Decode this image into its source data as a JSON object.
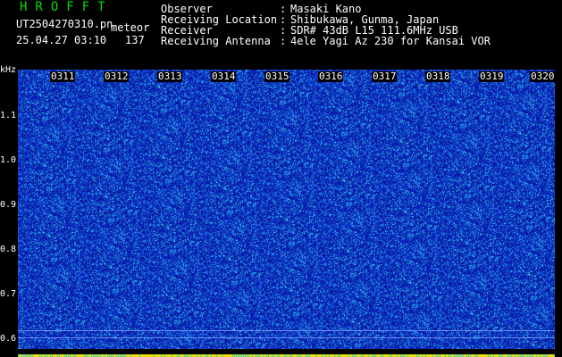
{
  "header": {
    "app_title": "HROFFT",
    "file_name": "UT2504270310.pn",
    "mode_label": "meteor",
    "datetime": "25.04.27 03:10",
    "count": "137",
    "info": [
      {
        "key": "Observer",
        "sep": ":",
        "value": "Masaki Kano"
      },
      {
        "key": "Receiving Location",
        "sep": ":",
        "value": "Shibukawa, Gunma, Japan"
      },
      {
        "key": "Receiver",
        "sep": ":",
        "value": "SDR# 43dB L15 111.6MHz USB"
      },
      {
        "key": "Receiving Antenna",
        "sep": ":",
        "value": "4ele Yagi Az 230 for Kansai VOR"
      }
    ]
  },
  "y_axis": {
    "unit": "kHz",
    "labels": [
      "1.1",
      "1.0",
      "0.9",
      "0.8",
      "0.7",
      "0.6"
    ]
  },
  "x_axis": {
    "labels": [
      "0311",
      "0312",
      "0313",
      "0314",
      "0315",
      "0316",
      "0317",
      "0318",
      "0319",
      "0320"
    ]
  },
  "colors": {
    "background": "#000000",
    "title_green": "#00e000",
    "text": "#ffffff",
    "waterfall_base": "#0a1fa8",
    "speckle_cyan": "#3fd0ff",
    "strip_yellow": "#f0e000"
  }
}
